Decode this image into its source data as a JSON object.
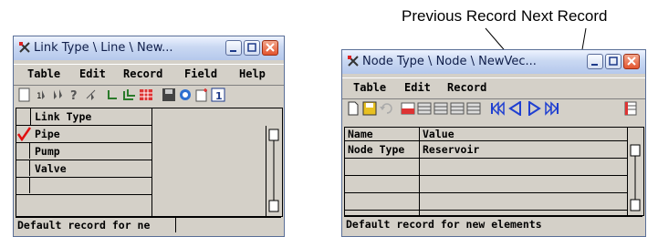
{
  "callouts": {
    "previous": "Previous Record",
    "next": "Next Record"
  },
  "link_window": {
    "title": "Link Type \\ Line \\ New...",
    "menu": [
      "Table",
      "Edit",
      "Record",
      "Field",
      "Help"
    ],
    "column_header": "Link Type",
    "rows": [
      {
        "value": "Pipe",
        "checked": true
      },
      {
        "value": "Pump",
        "checked": false
      },
      {
        "value": "Valve",
        "checked": false
      },
      {
        "value": "",
        "checked": false
      }
    ],
    "status": "Default record for ne"
  },
  "node_window": {
    "title": "Node Type \\ Node \\ NewVec...",
    "menu": [
      "Table",
      "Edit",
      "Record"
    ],
    "columns": [
      "Name",
      "Value"
    ],
    "rows": [
      {
        "name": "Node Type",
        "value": "Reservoir"
      },
      {
        "name": "",
        "value": ""
      },
      {
        "name": "",
        "value": ""
      },
      {
        "name": "",
        "value": ""
      }
    ],
    "status": "Default record for new elements"
  },
  "colors": {
    "title_gradient": "#c9d8f2",
    "close_button": "#e4552f",
    "check": "#e01010",
    "nav_arrows": "#1f3fd1"
  }
}
